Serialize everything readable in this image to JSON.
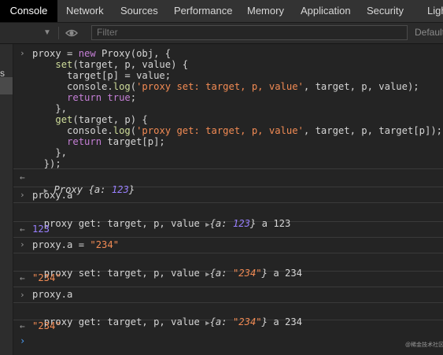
{
  "tabs": [
    "Console",
    "Network",
    "Sources",
    "Performance",
    "Memory",
    "Application",
    "Security",
    "Ligh"
  ],
  "toolbar": {
    "filter_placeholder": "Filter",
    "default_levels": "Default"
  },
  "sidebar": {
    "partial_label": "s"
  },
  "code_lines": [
    "proxy = new Proxy(obj, {",
    "    set(target, p, value) {",
    "      target[p] = value;",
    "      console.log('proxy set: target, p, value', target, p, value);",
    "      return true;",
    "    },",
    "    get(target, p) {",
    "      console.log('proxy get: target, p, value', target, p, target[p]);",
    "      return target[p];",
    "    },",
    "  });"
  ],
  "results": {
    "r1": {
      "label": "Proxy",
      "obj_prefix": "{a: ",
      "num": "123",
      "obj_suffix": "}"
    },
    "in2": "proxy.a",
    "log2": {
      "text": "proxy get: target, p, value",
      "obj_prefix": "{a: ",
      "num": "123",
      "obj_suffix": "}",
      "tail": "a 123"
    },
    "r2": "123",
    "in3_prefix": "proxy.a = ",
    "in3_str": "\"234\"",
    "log3": {
      "text": "proxy set: target, p, value",
      "obj_prefix": "{a: ",
      "str": "\"234\"",
      "obj_suffix": "}",
      "tail": "a 234"
    },
    "r3": "\"234\"",
    "in4": "proxy.a",
    "log4": {
      "text": "proxy get: target, p, value",
      "obj_prefix": "{a: ",
      "str": "\"234\"",
      "obj_suffix": "}",
      "tail": "a 234"
    },
    "r4": "\"234\""
  },
  "watermark": "@稀金技术社区",
  "colors": {
    "keyword": "#c57fd6",
    "function": "#cfdd9a",
    "string": "#f28b54",
    "number": "#9980ff",
    "prompt": "#4fa3ff"
  }
}
